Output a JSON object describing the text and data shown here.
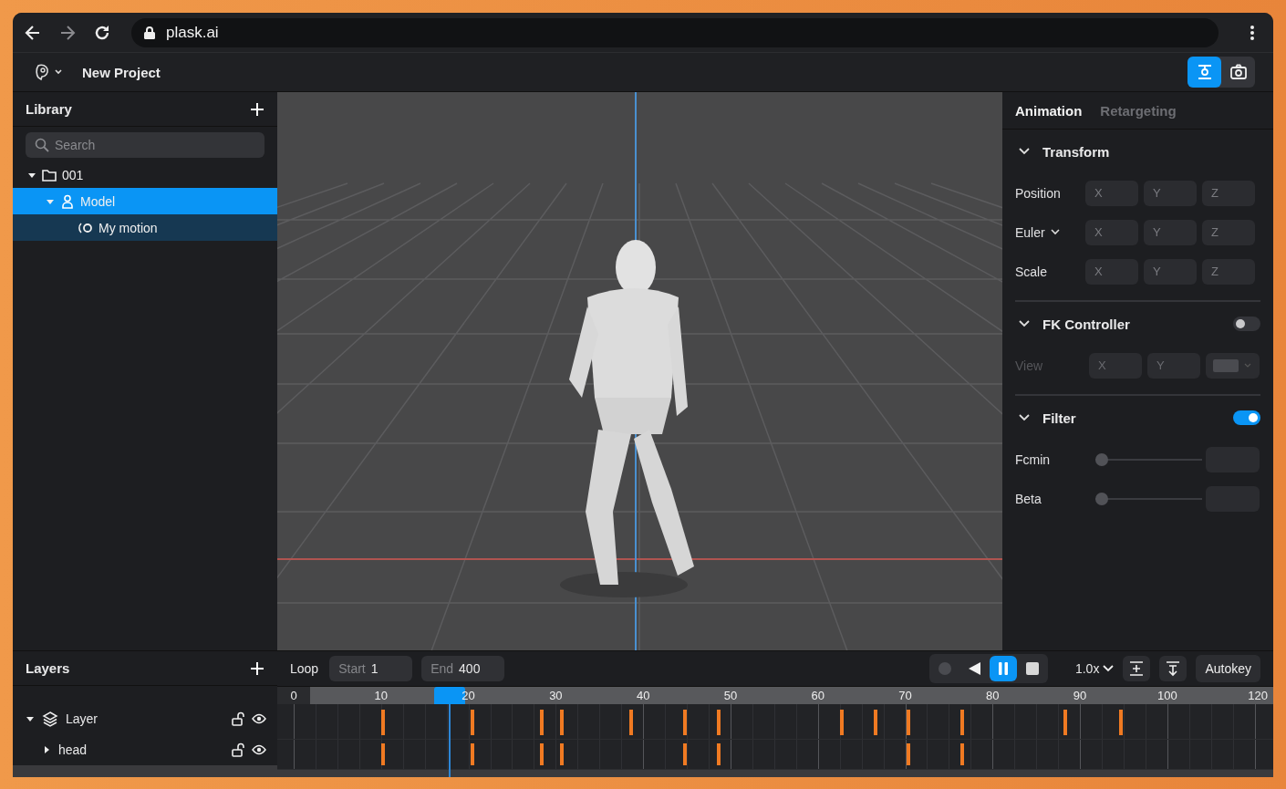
{
  "browser": {
    "url": "plask.ai"
  },
  "header": {
    "title": "New Project",
    "view_buttons": [
      {
        "kind": "gizmo",
        "selected": true
      },
      {
        "kind": "camera",
        "selected": false
      }
    ]
  },
  "library": {
    "title": "Library",
    "search": {
      "placeholder": "Search"
    },
    "tree": [
      {
        "label": "001",
        "kind": "folder",
        "expanded": true,
        "selected": false,
        "highlighted": false,
        "children": [
          {
            "label": "Model",
            "kind": "model",
            "expanded": true,
            "selected": true,
            "highlighted": false,
            "children": [
              {
                "label": "My motion",
                "kind": "motion",
                "selected": false,
                "highlighted": true
              }
            ]
          }
        ]
      }
    ]
  },
  "properties": {
    "tabs": [
      {
        "label": "Animation",
        "selected": true
      },
      {
        "label": "Retargeting",
        "selected": false
      }
    ],
    "sections": [
      {
        "title": "Transform",
        "expanded": true,
        "rows": [
          {
            "label": "Position",
            "kind": "fields",
            "disabled": false,
            "dropdown": false,
            "fields": [
              {
                "kind": "text",
                "placeholder": "X"
              },
              {
                "kind": "text",
                "placeholder": "Y"
              },
              {
                "kind": "text",
                "placeholder": "Z"
              }
            ]
          },
          {
            "label": "Euler",
            "kind": "fields",
            "disabled": false,
            "dropdown": true,
            "fields": [
              {
                "kind": "text",
                "placeholder": "X"
              },
              {
                "kind": "text",
                "placeholder": "Y"
              },
              {
                "kind": "text",
                "placeholder": "Z"
              }
            ]
          },
          {
            "label": "Scale",
            "kind": "fields",
            "disabled": false,
            "dropdown": false,
            "fields": [
              {
                "kind": "text",
                "placeholder": "X"
              },
              {
                "kind": "text",
                "placeholder": "Y"
              },
              {
                "kind": "text",
                "placeholder": "Z"
              }
            ]
          }
        ]
      },
      {
        "title": "FK Controller",
        "expanded": true,
        "on": false,
        "rows": [
          {
            "label": "View",
            "kind": "fields",
            "disabled": true,
            "dropdown": false,
            "fields": [
              {
                "kind": "text",
                "placeholder": "X"
              },
              {
                "kind": "text",
                "placeholder": "Y"
              },
              {
                "kind": "color"
              }
            ]
          }
        ]
      },
      {
        "title": "Filter",
        "expanded": true,
        "on": true,
        "rows": [
          {
            "label": "Fcmin",
            "kind": "slider",
            "disabled": false,
            "level": 0
          },
          {
            "label": "Beta",
            "kind": "slider",
            "disabled": false,
            "level": 0
          }
        ]
      }
    ]
  },
  "layers": {
    "title": "Layers",
    "items": [
      {
        "label": "Layer",
        "kind": "layer",
        "expanded": true,
        "locked": false,
        "visible": true,
        "children": [
          {
            "label": "head",
            "expanded": false,
            "locked": false,
            "visible": true
          }
        ]
      }
    ]
  },
  "timeline": {
    "loop": "Loop",
    "start": {
      "label": "Start",
      "value": "1"
    },
    "end": {
      "label": "End",
      "value": "400"
    },
    "transport": [
      {
        "kind": "record",
        "selected": false
      },
      {
        "kind": "reverse",
        "selected": false
      },
      {
        "kind": "pause",
        "selected": true
      },
      {
        "kind": "stop",
        "selected": false
      }
    ],
    "speed": "1.0x",
    "tools": [
      {
        "kind": "fit"
      },
      {
        "kind": "insert"
      }
    ],
    "autokey": "Autokey",
    "ruler": [
      "0",
      "10",
      "20",
      "30",
      "40",
      "50",
      "60",
      "70",
      "80",
      "90",
      "100",
      "120"
    ],
    "playhead": {
      "level": 0.173
    },
    "tracks": [
      {
        "keys": [
          {
            "level": 0.106
          },
          {
            "level": 0.196
          },
          {
            "level": 0.266
          },
          {
            "level": 0.286
          },
          {
            "level": 0.355
          },
          {
            "level": 0.409
          },
          {
            "level": 0.443
          },
          {
            "level": 0.567
          },
          {
            "level": 0.601
          },
          {
            "level": 0.634
          },
          {
            "level": 0.688
          },
          {
            "level": 0.791
          },
          {
            "level": 0.847
          }
        ]
      },
      {
        "keys": [
          {
            "level": 0.106
          },
          {
            "level": 0.196
          },
          {
            "level": 0.266
          },
          {
            "level": 0.286
          },
          {
            "level": 0.409
          },
          {
            "level": 0.443
          },
          {
            "level": 0.634
          },
          {
            "level": 0.688
          }
        ]
      }
    ]
  }
}
